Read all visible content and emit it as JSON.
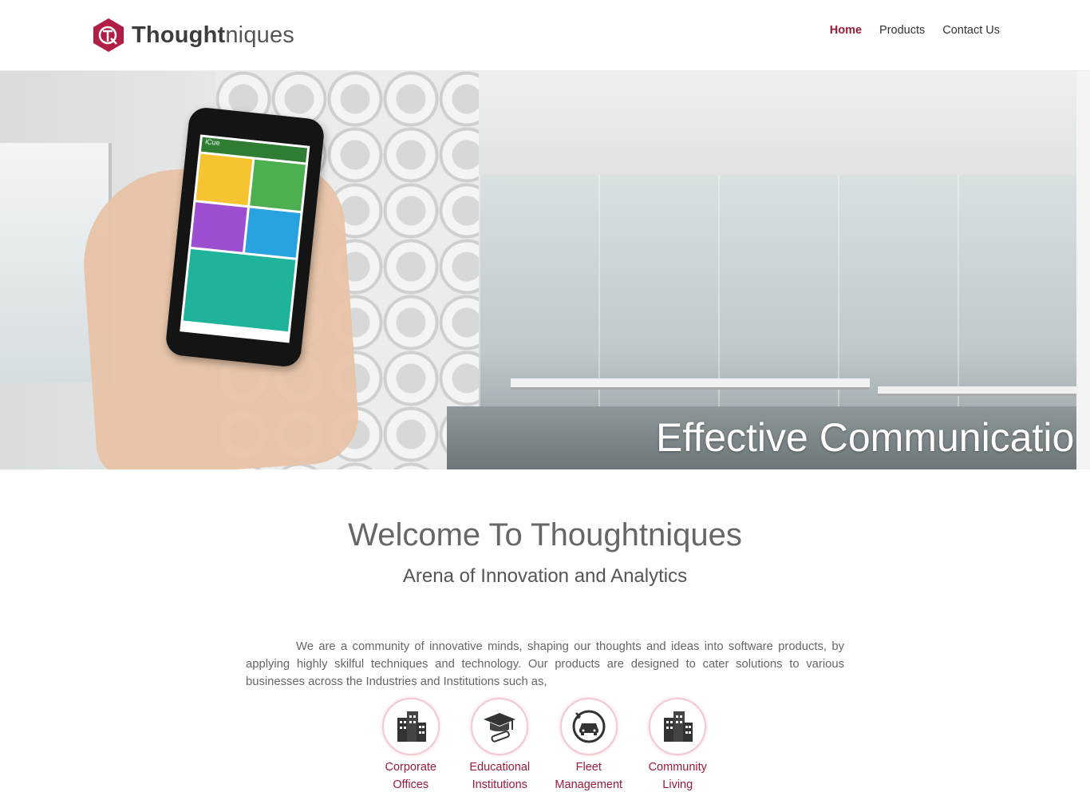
{
  "brand": {
    "name_bold": "Thought",
    "name_light": "niques",
    "accent_color": "#9b1b3a"
  },
  "nav": {
    "items": [
      {
        "label": "Home",
        "active": true
      },
      {
        "label": "Products",
        "active": false
      },
      {
        "label": "Contact Us",
        "active": false
      }
    ]
  },
  "hero": {
    "caption": "Effective Communicatio",
    "phone_app_title": "iCue"
  },
  "welcome": {
    "title": "Welcome To Thoughtniques",
    "tagline": "Arena of Innovation and Analytics",
    "intro": "We are a community of innovative minds, shaping our thoughts and ideas into software products, by applying highly skilful techniques and technology. Our products are designed to cater solutions to various businesses across the Industries and Institutions such as,"
  },
  "sectors": [
    {
      "line1": "Corporate",
      "line2": "Offices",
      "icon": "building-icon"
    },
    {
      "line1": "Educational",
      "line2": "Institutions",
      "icon": "graduation-cap-icon"
    },
    {
      "line1": "Fleet",
      "line2": "Management",
      "icon": "vehicle-icon"
    },
    {
      "line1": "Community",
      "line2": "Living",
      "icon": "building-icon"
    }
  ]
}
